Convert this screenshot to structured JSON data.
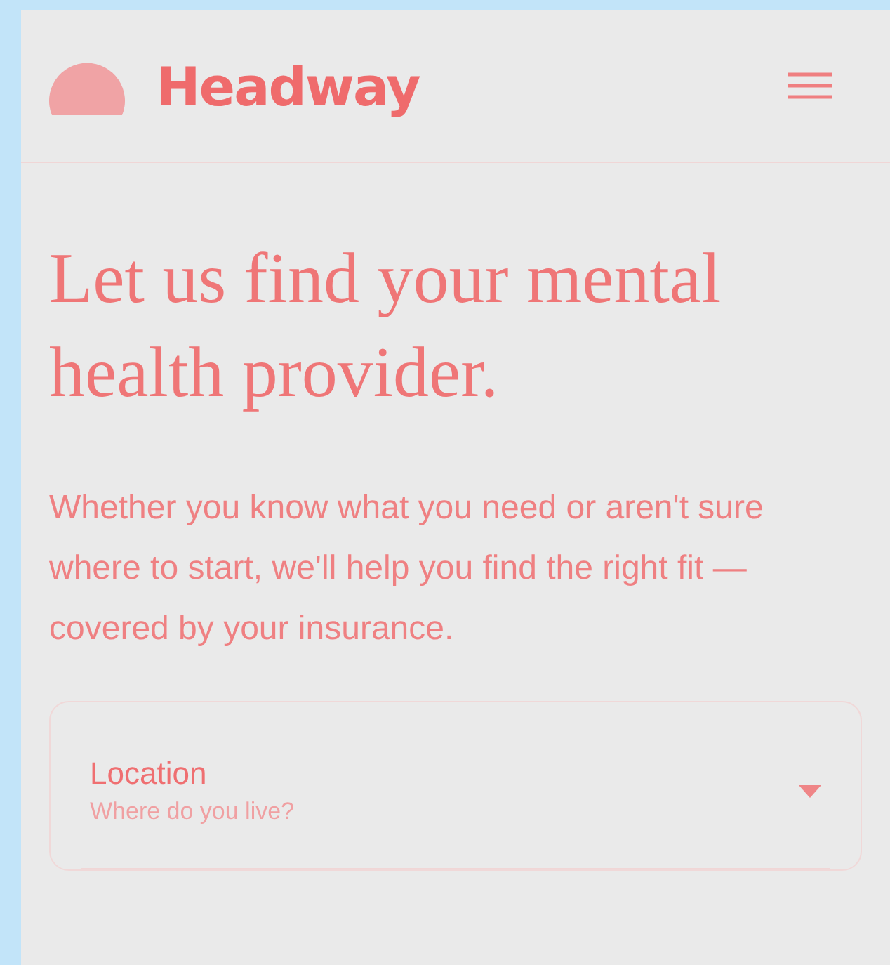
{
  "header": {
    "brand": "Headway"
  },
  "headline": "Let us find your mental health provider.",
  "intro": "Whether you know what you need or aren't sure where to start, we'll help you find the right fit — covered by your insurance.",
  "form": {
    "fields": [
      {
        "kind": "dropdown",
        "label": "Location",
        "placeholder": "Where do you live?"
      }
    ]
  }
}
